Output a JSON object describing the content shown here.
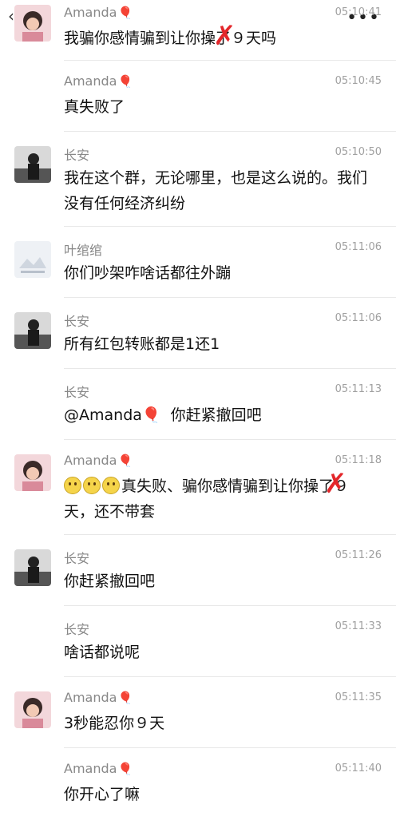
{
  "header": {
    "back_glyph": "‹",
    "more_glyph": "•••"
  },
  "messages": [
    {
      "sender": "Amanda",
      "balloon": "🎈",
      "time": "05:10:41",
      "text": "我骗你感情骗到让你操了９天吗",
      "avatar": "amanda"
    },
    {
      "sender": "Amanda",
      "balloon": "🎈",
      "time": "05:10:45",
      "text": "真失败了",
      "avatar": "none"
    },
    {
      "sender": "长安",
      "balloon": "",
      "time": "05:10:50",
      "text": "我在这个群，无论哪里，也是这么说的。我们没有任何经济纠纷",
      "avatar": "changan"
    },
    {
      "sender": "叶绾绾",
      "balloon": "",
      "time": "05:11:06",
      "text": "你们吵架咋啥话都往外蹦",
      "avatar": "ye"
    },
    {
      "sender": "长安",
      "balloon": "",
      "time": "05:11:06",
      "text": "所有红包转账都是1还1",
      "avatar": "changan"
    },
    {
      "sender": "长安",
      "balloon": "",
      "time": "05:11:13",
      "text_prefix": "@Amanda",
      "text_balloon": "🎈",
      "text": "你赶紧撤回吧",
      "avatar": "none"
    },
    {
      "sender": "Amanda",
      "balloon": "🎈",
      "time": "05:11:18",
      "text": "真失败、骗你感情骗到让你操了９天，还不带套",
      "avatar": "amanda"
    },
    {
      "sender": "长安",
      "balloon": "",
      "time": "05:11:26",
      "text": "你赶紧撤回吧",
      "avatar": "changan"
    },
    {
      "sender": "长安",
      "balloon": "",
      "time": "05:11:33",
      "text": "啥话都说呢",
      "avatar": "none"
    },
    {
      "sender": "Amanda",
      "balloon": "🎈",
      "time": "05:11:35",
      "text": "3秒能忍你９天",
      "avatar": "amanda"
    },
    {
      "sender": "Amanda",
      "balloon": "🎈",
      "time": "05:11:40",
      "text": "你开心了嘛",
      "avatar": "none"
    }
  ],
  "placeholder_avatar_caption": "图片 加载失败",
  "colors": {
    "time": "#a0a0a0",
    "name": "#888888",
    "redx": "#e3262a"
  }
}
